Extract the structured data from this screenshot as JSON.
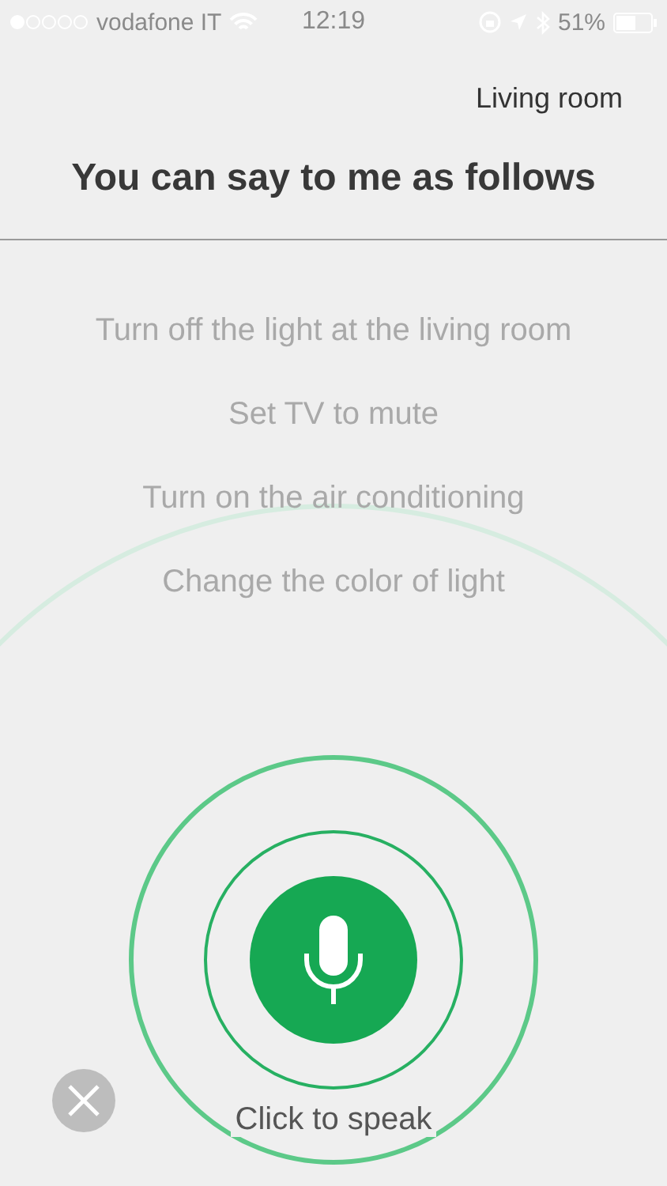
{
  "status_bar": {
    "carrier": "vodafone IT",
    "time": "12:19",
    "battery": "51%"
  },
  "room": {
    "label": "Living room"
  },
  "title": "You can say to me as follows",
  "suggestions": [
    "Turn off the light at the living room",
    "Set TV to mute",
    "Turn on the air conditioning",
    "Change the color of light"
  ],
  "voice": {
    "caption": "Click to speak"
  }
}
